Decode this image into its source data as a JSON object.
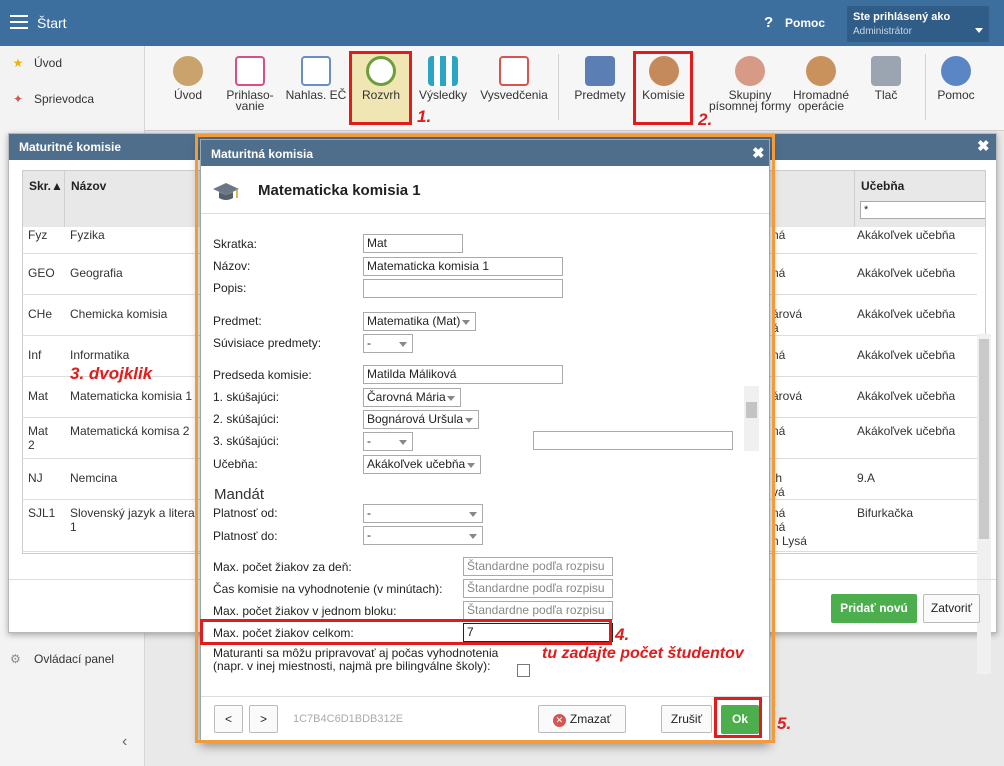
{
  "app": {
    "title": "Štart",
    "help_icon": "?",
    "help_label": "Pomoc",
    "user_line1": "Ste prihlásený ako",
    "user_line2": "Administrátor"
  },
  "sidebar": {
    "items": [
      {
        "label": "Úvod",
        "icon": "star-icon"
      },
      {
        "label": "Sprievodca",
        "icon": "wand-icon"
      },
      {
        "label": "Ovládací panel",
        "icon": "gear-icon"
      }
    ]
  },
  "toolbar": {
    "items": [
      {
        "label": "Úvod"
      },
      {
        "label": "Prihlaso-\nvanie"
      },
      {
        "label": "Nahlas. EČ"
      },
      {
        "label": "Rozvrh"
      },
      {
        "label": "Výsledky"
      },
      {
        "label": "Vysvedčenia"
      },
      {
        "label": "Predmety"
      },
      {
        "label": "Komisie"
      },
      {
        "label": "Skupiny\npísomnej formy"
      },
      {
        "label": "Hromadné\noperácie"
      },
      {
        "label": "Tlač"
      },
      {
        "label": "Pomoc"
      }
    ]
  },
  "bg_dialog": {
    "title": "Maturitné komisie",
    "close": "✖",
    "columns": {
      "skr": "Skr.▲",
      "nazov": "Názov",
      "ucebna": "Učebňa",
      "ucebna_filter": "*"
    },
    "rows": [
      {
        "skr": "Fyz",
        "nazov": "Fyzika",
        "col3": "ná",
        "ucebna": "Akákoľvek učebňa"
      },
      {
        "skr": "GEO",
        "nazov": "Geografia",
        "col3": "ná",
        "ucebna": "Akákoľvek učebňa"
      },
      {
        "skr": "CHe",
        "nazov": "Chemicka komisia",
        "col3": "árová\ná",
        "ucebna": "Akákoľvek učebňa"
      },
      {
        "skr": "Inf",
        "nazov": "Informatika",
        "col3": "ná",
        "ucebna": "Akákoľvek učebňa"
      },
      {
        "skr": "Mat",
        "nazov": "Matematicka komisia 1",
        "col3": "árová",
        "ucebna": "Akákoľvek učebňa"
      },
      {
        "skr": "Mat\n2",
        "nazov": "Matematická komisa 2",
        "col3": "ná",
        "ucebna": "Akákoľvek učebňa"
      },
      {
        "skr": "NJ",
        "nazov": "Nemcina",
        "col3": "th\nvá",
        "ucebna": "9.A"
      },
      {
        "skr": "SJL1",
        "nazov": "Slovenský jazyk a litera\n1",
        "col3": "ná\nná\nn Lysá",
        "ucebna": "Bifurkačka"
      }
    ],
    "btn_pridat": "Pridať novú",
    "btn_zatvorit": "Zatvoriť"
  },
  "dlg": {
    "title": "Maturitná komisia",
    "close": "✖",
    "subtitle": "Matematicka komisia 1",
    "labels": {
      "skratka": "Skratka:",
      "nazov": "Názov:",
      "popis": "Popis:",
      "predmet": "Predmet:",
      "suvisiace": "Súvisiace predmety:",
      "predseda": "Predseda komisie:",
      "s1": "1. skúšajúci:",
      "s2": "2. skúšajúci:",
      "s3": "3. skúšajúci:",
      "ucebna": "Učebňa:",
      "mandat": "Mandát",
      "platnost_od": "Platnosť od:",
      "platnost_do": "Platnosť do:",
      "max_den": "Max. počet žiakov za deň:",
      "cas": "Čas komisie na vyhodnotenie (v minútach):",
      "max_blok": "Max. počet žiakov v jednom bloku:",
      "max_celkom": "Max. počet žiakov celkom:",
      "maturanti": "Maturanti sa môžu pripravovať aj počas vyhodnotenia\n(napr. v inej miestnosti, najmä pre bilingválne školy):"
    },
    "values": {
      "skratka": "Mat",
      "nazov": "Matematicka komisia 1",
      "popis": "",
      "predmet": "Matematika (Mat)",
      "suvisiace": "-",
      "predseda": "Matilda Máliková",
      "s1": "Čarovná Mária",
      "s2": "Bognárová Uršula",
      "s3": "-",
      "s3_extra": "",
      "ucebna": "Akákoľvek učebňa",
      "platnost_od": "-",
      "platnost_do": "-",
      "max_celkom": "7"
    },
    "placeholders": {
      "max_den": "Štandardne podľa rozpisu",
      "cas": "Štandardne podľa rozpisu",
      "max_blok": "Štandardne podľa rozpisu"
    },
    "footer": {
      "prev": "<",
      "next": ">",
      "guid": "1C7B4C6D1BDB312E",
      "zmazat": "Zmazať",
      "zrusit": "Zrušiť",
      "ok": "Ok"
    }
  },
  "annotations": {
    "a1": "1.",
    "a2": "2.",
    "a3": "3. dvojklik",
    "a4": "4.",
    "a4_text": "tu zadajte počet študentov",
    "a5": "5."
  },
  "colors": {
    "header": "#3d6f9e",
    "dialog_header": "#4e6e8c",
    "ok_green": "#4cae4c",
    "annotation_red": "#e21b1b",
    "highlight_orange": "#f39a3a"
  }
}
